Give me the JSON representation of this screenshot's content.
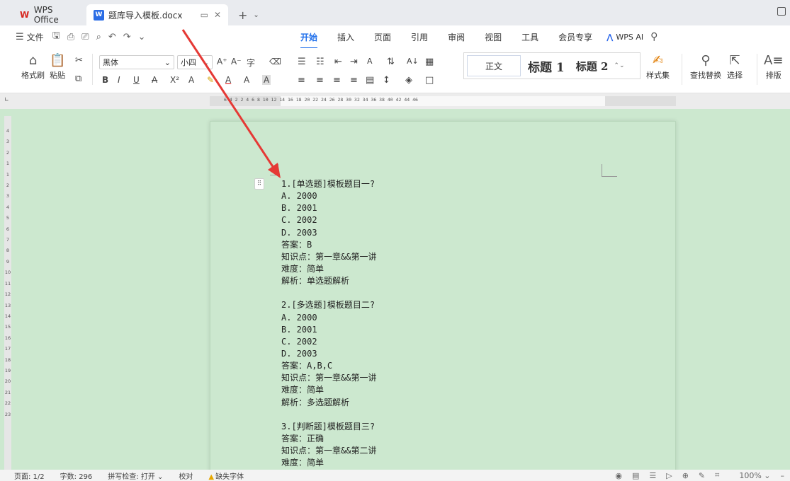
{
  "tabs": {
    "home": "WPS Office",
    "doc": "题库导入模板.docx",
    "doc_badge": "W",
    "home_badge": "W"
  },
  "menu": {
    "file": "文件",
    "tabs": [
      "开始",
      "插入",
      "页面",
      "引用",
      "审阅",
      "视图",
      "工具",
      "会员专享"
    ],
    "ai": "WPS AI"
  },
  "ribbon": {
    "format_painter": "格式刷",
    "paste": "粘贴",
    "font": "黑体",
    "font_size": "小四",
    "style_normal": "正文",
    "style_h1": "标题 1",
    "style_h2": "标题 2",
    "style_set": "样式集",
    "find_replace": "查找替换",
    "select": "选择",
    "layout": "排版"
  },
  "ruler": {
    "numbers": "6   4   2       2   4   6   8   10  12  14  16  18  20  22  24  26  28  30  32  34  36  38  40  42  44  46",
    "vertical": [
      "4",
      "3",
      "2",
      "1",
      "",
      "1",
      "2",
      "3",
      "4",
      "5",
      "6",
      "7",
      "8",
      "9",
      "10",
      "11",
      "12",
      "13",
      "14",
      "15",
      "16",
      "17",
      "18",
      "19",
      "20",
      "21",
      "22",
      "23"
    ]
  },
  "document": {
    "lines": [
      "1.[单选题]模板题目一?",
      "A. 2000",
      "B. 2001",
      "C. 2002",
      "D. 2003",
      "答案：B",
      "知识点：第一章&&第一讲",
      "难度：简单",
      "解析：单选题解析",
      "",
      "2.[多选题]模板题目二?",
      "A. 2000",
      "B. 2001",
      "C. 2002",
      "D. 2003",
      "答案：A,B,C",
      "知识点：第一章&&第一讲",
      "难度：简单",
      "解析：多选题解析",
      "",
      "3.[判断题]模板题目三?",
      "答案：正确",
      "知识点：第一章&&第二讲",
      "难度：简单"
    ]
  },
  "status": {
    "page": "页面: 1/2",
    "words": "字数: 296",
    "spell": "拼写检查: 打开",
    "proof": "校对",
    "missing_font": "缺失字体",
    "zoom": "100%"
  },
  "colors": {
    "page_bg": "#cce8cf",
    "accent": "#1f6feb",
    "arrow": "#e53935"
  }
}
